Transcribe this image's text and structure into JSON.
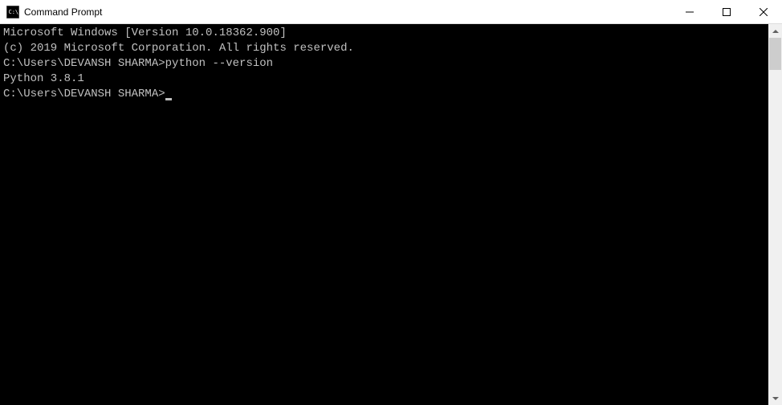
{
  "titlebar": {
    "title": "Command Prompt"
  },
  "terminal": {
    "line1": "Microsoft Windows [Version 10.0.18362.900]",
    "line2": "(c) 2019 Microsoft Corporation. All rights reserved.",
    "blank1": "",
    "prompt1": "C:\\Users\\DEVANSH SHARMA>",
    "command1": "python --version",
    "output1": "Python 3.8.1",
    "blank2": "",
    "prompt2": "C:\\Users\\DEVANSH SHARMA>"
  }
}
